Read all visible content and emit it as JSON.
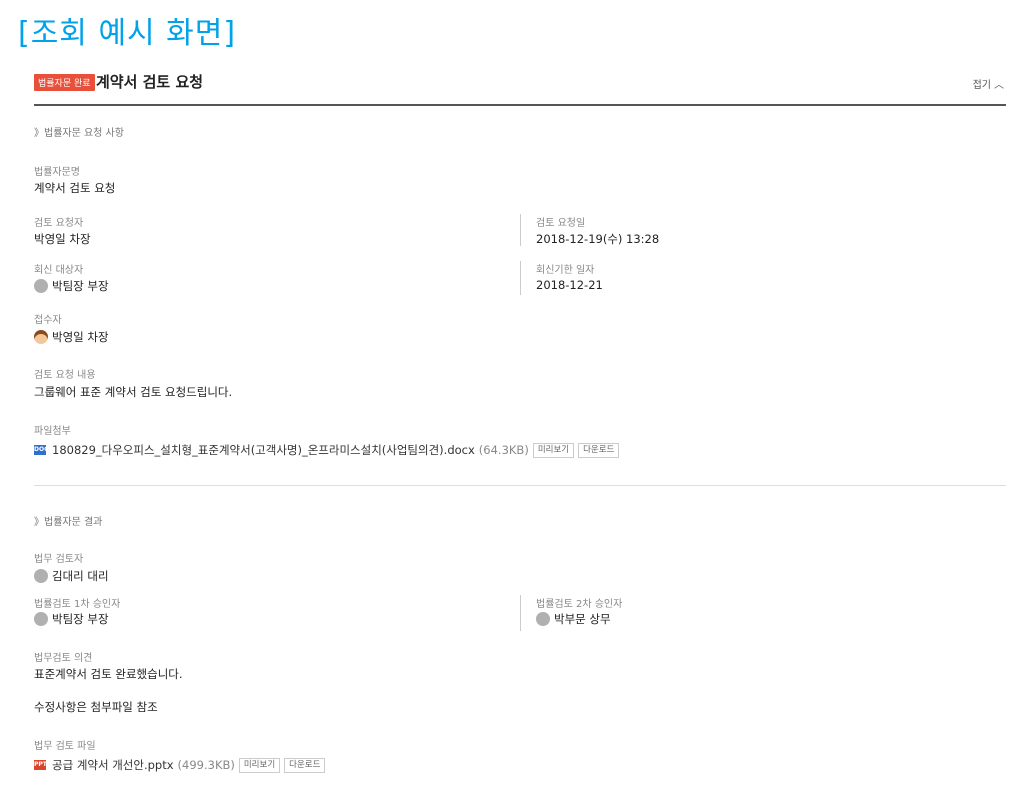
{
  "caption": "[조회 예시 화면]",
  "header": {
    "badge": "법률자문 완료",
    "title": "계약서 검토 요청",
    "fold_label": "접기",
    "fold_icon": "chevron-up-icon"
  },
  "request_section": {
    "title": "》법률자문 요청 사항",
    "name_label": "법률자문명",
    "name_value": "계약서 검토 요청",
    "requester_label": "검토 요청자",
    "requester_value": "박영일 차장",
    "request_date_label": "검토 요청일",
    "request_date_value": "2018-12-19(수) 13:28",
    "reply_target_label": "회신 대상자",
    "reply_target_value": "박팀장 부장",
    "reply_deadline_label": "회신기한 일자",
    "reply_deadline_value": "2018-12-21",
    "receiver_label": "접수자",
    "receiver_value": "박영일 차장",
    "content_label": "검토 요청 내용",
    "content_value": "그룹웨어 표준 계약서 검토 요청드립니다.",
    "attach_label": "파일첨부",
    "attach_file": {
      "icon": "doc-file-icon",
      "icon_text": "DOC",
      "name": "180829_다우오피스_설치형_표준계약서(고객사명)_온프라미스설치(사업팀의견).docx",
      "size": "(64.3KB)",
      "preview": "미리보기",
      "download": "다운로드"
    }
  },
  "result_section": {
    "title": "》법률자문 결과",
    "reviewer_label": "법무 검토자",
    "reviewer_value": "김대리 대리",
    "approver1_label": "법률검토 1차 승인자",
    "approver1_value": "박팀장 부장",
    "approver2_label": "법률검토 2차 승인자",
    "approver2_value": "박부문 상무",
    "opinion_label": "법무검토 의견",
    "opinion_line1": "표준계약서 검토 완료했습니다.",
    "opinion_line2": "수정사항은 첨부파일 참조",
    "file_label": "법무 검토 파일",
    "file": {
      "icon": "ppt-file-icon",
      "icon_text": "PPT",
      "name": "공급 계약서 개선안.pptx",
      "size": "(499.3KB)",
      "preview": "미리보기",
      "download": "다운로드"
    }
  }
}
